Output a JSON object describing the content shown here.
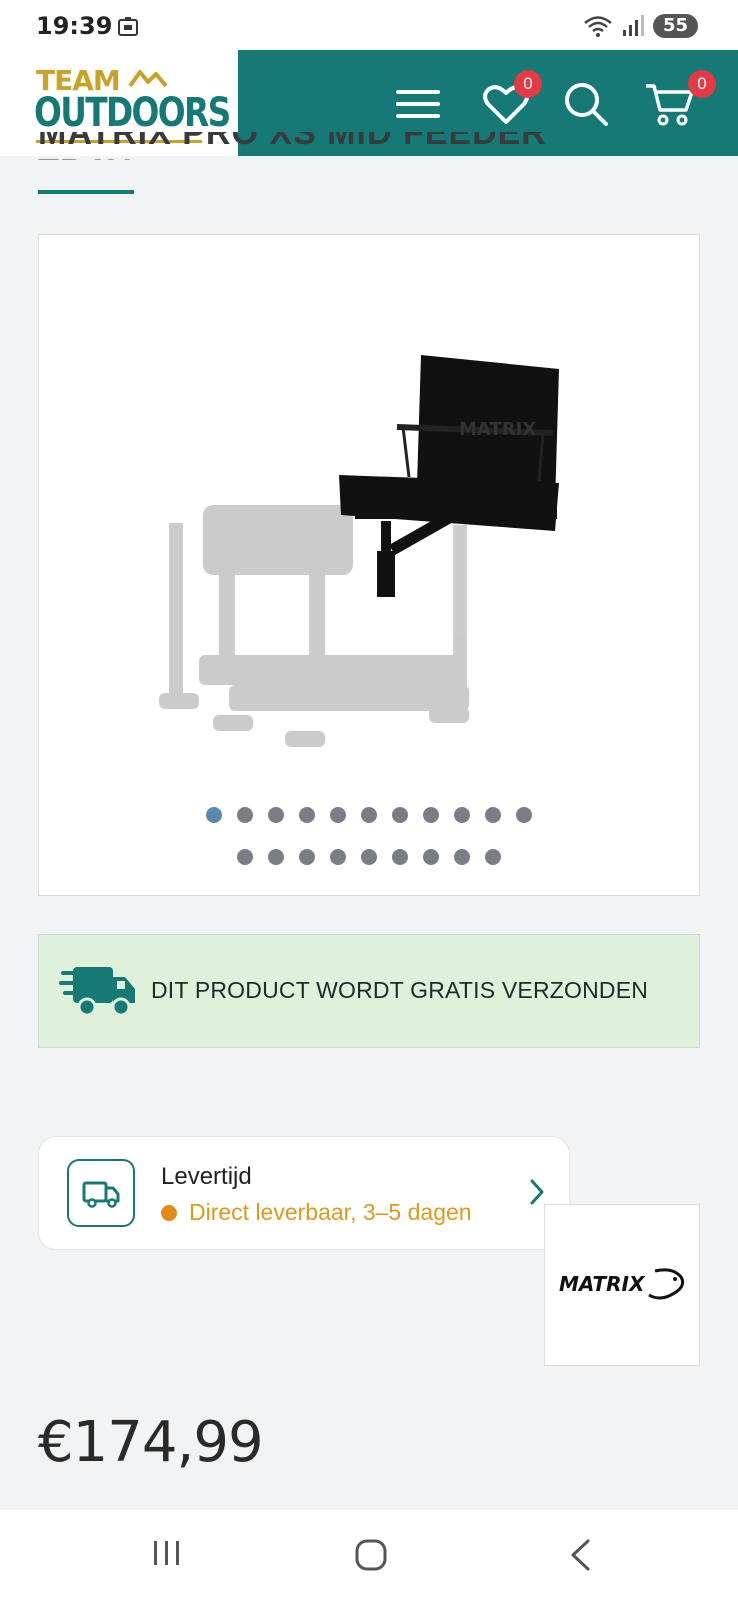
{
  "status_bar": {
    "time": "19:39",
    "battery": "55"
  },
  "header": {
    "logo": {
      "line1": "TEAM",
      "line2": "OUTDOORS"
    },
    "wishlist_count": "0",
    "cart_count": "0"
  },
  "product": {
    "title": "MATRIX PRO XS MID FEEDER TRAY",
    "image_count": 20,
    "active_image_index": 0,
    "shipping_banner": "DIT PRODUCT WORDT GRATIS VERZONDEN",
    "delivery": {
      "label": "Levertijd",
      "status": "Direct leverbaar, 3–5 dagen"
    },
    "brand": "MATRIX",
    "price": "€174,99",
    "product_image_text": "MATRIX"
  },
  "colors": {
    "brand_teal": "#157a75",
    "brand_gold": "#c9a227",
    "badge_red": "#e53945",
    "status_orange": "#e08a18",
    "banner_green": "#dff0db"
  }
}
